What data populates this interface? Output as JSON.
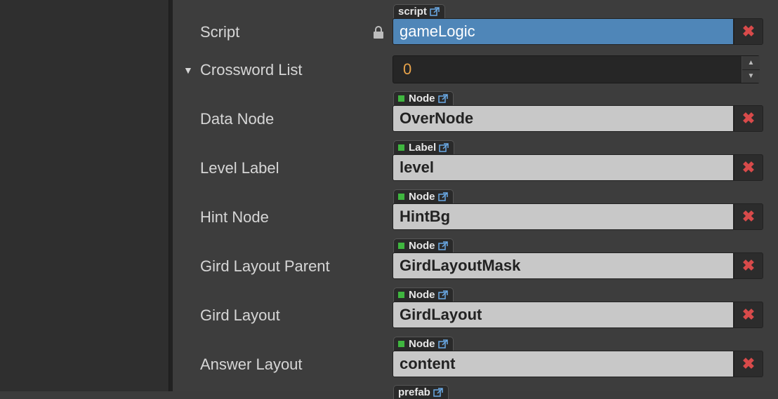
{
  "rows": {
    "script": {
      "label": "Script",
      "tab": "script",
      "value": "gameLogic"
    },
    "crossword": {
      "label": "Crossword List",
      "value": "0"
    },
    "data_node": {
      "label": "Data Node",
      "tab": "Node",
      "value": "OverNode"
    },
    "level_label": {
      "label": "Level Label",
      "tab": "Label",
      "value": "level"
    },
    "hint_node": {
      "label": "Hint Node",
      "tab": "Node",
      "value": "HintBg"
    },
    "grid_parent": {
      "label": "Gird Layout Parent",
      "tab": "Node",
      "value": "GirdLayoutMask"
    },
    "grid_layout": {
      "label": "Gird Layout",
      "tab": "Node",
      "value": "GirdLayout"
    },
    "answer_layout": {
      "label": "Answer Layout",
      "tab": "Node",
      "value": "content"
    },
    "next_tab": "prefab"
  },
  "icons": {
    "clear": "x-icon",
    "lock": "lock-icon",
    "expand": "triangle-down-icon",
    "external": "external-link-icon"
  },
  "colors": {
    "script_field": "#4f86b8",
    "clear_x": "#d84a4a",
    "number_text": "#e8a34a",
    "node_square": "#3fb63f"
  }
}
